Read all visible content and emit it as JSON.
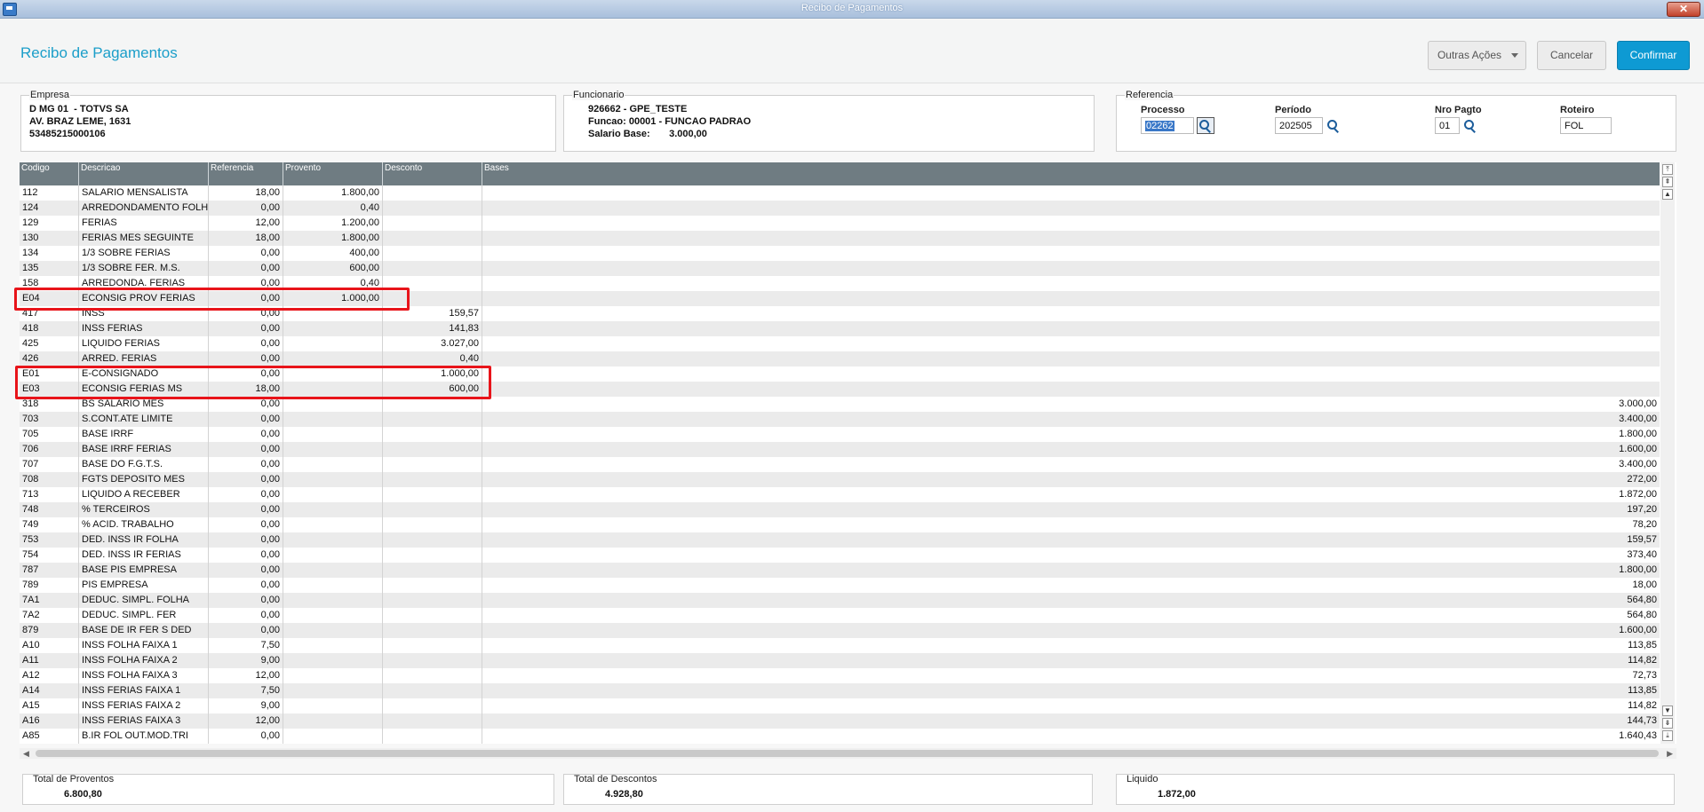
{
  "window": {
    "title": "Recibo de Pagamentos",
    "close_label": "✕"
  },
  "header": {
    "page_title": "Recibo de Pagamentos",
    "outras_label": "Outras Ações",
    "cancel_label": "Cancelar",
    "confirm_label": "Confirmar"
  },
  "empresa": {
    "legend": "Empresa",
    "line1": "D MG 01  - TOTVS SA",
    "line2": "AV. BRAZ LEME, 1631",
    "line3": "53485215000106"
  },
  "funcionario": {
    "legend": "Funcionario",
    "line1": "926662 - GPE_TESTE",
    "line2": "Funcao: 00001 - FUNCAO PADRAO",
    "line3": "Salario Base:       3.000,00"
  },
  "referencia": {
    "legend": "Referencia",
    "processo_label": "Processo",
    "processo_value": "02262",
    "periodo_label": "Período",
    "periodo_value": "202505",
    "nropagto_label": "Nro Pagto",
    "nropagto_value": "01",
    "roteiro_label": "Roteiro",
    "roteiro_value": "FOL"
  },
  "grid": {
    "columns": [
      "Codigo",
      "Descricao",
      "Referencia",
      "Provento",
      "Desconto",
      "Bases"
    ],
    "rows": [
      [
        "112",
        "SALARIO MENSALISTA",
        "18,00",
        "1.800,00",
        "",
        ""
      ],
      [
        "124",
        "ARREDONDAMENTO FOLHA",
        "0,00",
        "0,40",
        "",
        ""
      ],
      [
        "129",
        "FERIAS",
        "12,00",
        "1.200,00",
        "",
        ""
      ],
      [
        "130",
        "FERIAS MES SEGUINTE",
        "18,00",
        "1.800,00",
        "",
        ""
      ],
      [
        "134",
        "1/3 SOBRE FERIAS",
        "0,00",
        "400,00",
        "",
        ""
      ],
      [
        "135",
        "1/3 SOBRE FER. M.S.",
        "0,00",
        "600,00",
        "",
        ""
      ],
      [
        "158",
        "ARREDONDA. FERIAS",
        "0,00",
        "0,40",
        "",
        ""
      ],
      [
        "E04",
        "ECONSIG PROV FERIAS",
        "0,00",
        "1.000,00",
        "",
        ""
      ],
      [
        "417",
        "INSS",
        "0,00",
        "",
        "159,57",
        ""
      ],
      [
        "418",
        "INSS FERIAS",
        "0,00",
        "",
        "141,83",
        ""
      ],
      [
        "425",
        "LIQUIDO FERIAS",
        "0,00",
        "",
        "3.027,00",
        ""
      ],
      [
        "426",
        "ARRED. FERIAS",
        "0,00",
        "",
        "0,40",
        ""
      ],
      [
        "E01",
        "E-CONSIGNADO",
        "0,00",
        "",
        "1.000,00",
        ""
      ],
      [
        "E03",
        "ECONSIG FERIAS MS",
        "18,00",
        "",
        "600,00",
        ""
      ],
      [
        "318",
        "BS SALARIO MES",
        "0,00",
        "",
        "",
        "3.000,00"
      ],
      [
        "703",
        "S.CONT.ATE LIMITE",
        "0,00",
        "",
        "",
        "3.400,00"
      ],
      [
        "705",
        "BASE IRRF",
        "0,00",
        "",
        "",
        "1.800,00"
      ],
      [
        "706",
        "BASE IRRF FERIAS",
        "0,00",
        "",
        "",
        "1.600,00"
      ],
      [
        "707",
        "BASE DO F.G.T.S.",
        "0,00",
        "",
        "",
        "3.400,00"
      ],
      [
        "708",
        "FGTS DEPOSITO MES",
        "0,00",
        "",
        "",
        "272,00"
      ],
      [
        "713",
        "LIQUIDO A RECEBER",
        "0,00",
        "",
        "",
        "1.872,00"
      ],
      [
        "748",
        "% TERCEIROS",
        "0,00",
        "",
        "",
        "197,20"
      ],
      [
        "749",
        "% ACID. TRABALHO",
        "0,00",
        "",
        "",
        "78,20"
      ],
      [
        "753",
        "DED. INSS IR FOLHA",
        "0,00",
        "",
        "",
        "159,57"
      ],
      [
        "754",
        "DED. INSS IR FERIAS",
        "0,00",
        "",
        "",
        "373,40"
      ],
      [
        "787",
        "BASE PIS EMPRESA",
        "0,00",
        "",
        "",
        "1.800,00"
      ],
      [
        "789",
        "PIS EMPRESA",
        "0,00",
        "",
        "",
        "18,00"
      ],
      [
        "7A1",
        "DEDUC. SIMPL. FOLHA",
        "0,00",
        "",
        "",
        "564,80"
      ],
      [
        "7A2",
        "DEDUC. SIMPL. FER",
        "0,00",
        "",
        "",
        "564,80"
      ],
      [
        "879",
        "BASE DE IR FER S DED",
        "0,00",
        "",
        "",
        "1.600,00"
      ],
      [
        "A10",
        "INSS FOLHA FAIXA 1",
        "7,50",
        "",
        "",
        "113,85"
      ],
      [
        "A11",
        "INSS FOLHA FAIXA 2",
        "9,00",
        "",
        "",
        "114,82"
      ],
      [
        "A12",
        "INSS FOLHA FAIXA 3",
        "12,00",
        "",
        "",
        "72,73"
      ],
      [
        "A14",
        "INSS FERIAS FAIXA 1",
        "7,50",
        "",
        "",
        "113,85"
      ],
      [
        "A15",
        "INSS FERIAS FAIXA 2",
        "9,00",
        "",
        "",
        "114,82"
      ],
      [
        "A16",
        "INSS FERIAS FAIXA 3",
        "12,00",
        "",
        "",
        "144,73"
      ],
      [
        "A85",
        "B.IR FOL OUT.MOD.TRI",
        "0,00",
        "",
        "",
        "1.640,43"
      ]
    ]
  },
  "totals": {
    "proventos_label": "Total de Proventos",
    "proventos_value": "6.800,80",
    "descontos_label": "Total de Descontos",
    "descontos_value": "4.928,80",
    "liquido_label": "Liquido",
    "liquido_value": "1.872,00"
  },
  "colors": {
    "accent": "#1b9ec9",
    "confirm": "#0e9ad3",
    "highlight": "#e8141a",
    "grid_header": "#6f7c82"
  }
}
